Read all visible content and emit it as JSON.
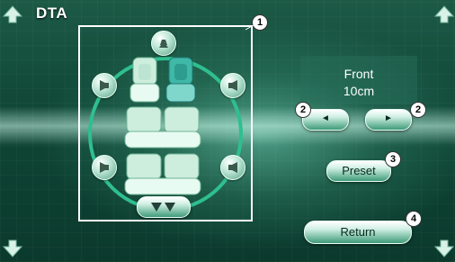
{
  "screen": {
    "title": "DTA"
  },
  "position_display": {
    "position": "Front",
    "distance": "10cm"
  },
  "buttons": {
    "preset_label": "Preset",
    "return_label": "Return",
    "left_arrow": "◄",
    "right_arrow": "►"
  },
  "callouts": {
    "c1": "1",
    "c2a": "2",
    "c2b": "2",
    "c3": "3",
    "c4": "4"
  },
  "seats": {
    "selected": "front-right",
    "highlight_color": "#3fb8a8"
  },
  "colors": {
    "background": "#0f4535",
    "ring": "#2fbf8e",
    "frame": "#ffffff"
  },
  "icons": [
    "speaker-front-icon",
    "speaker-left-icon",
    "speaker-right-icon",
    "subwoofer-icon",
    "up-arrow-icon",
    "down-arrow-icon"
  ]
}
